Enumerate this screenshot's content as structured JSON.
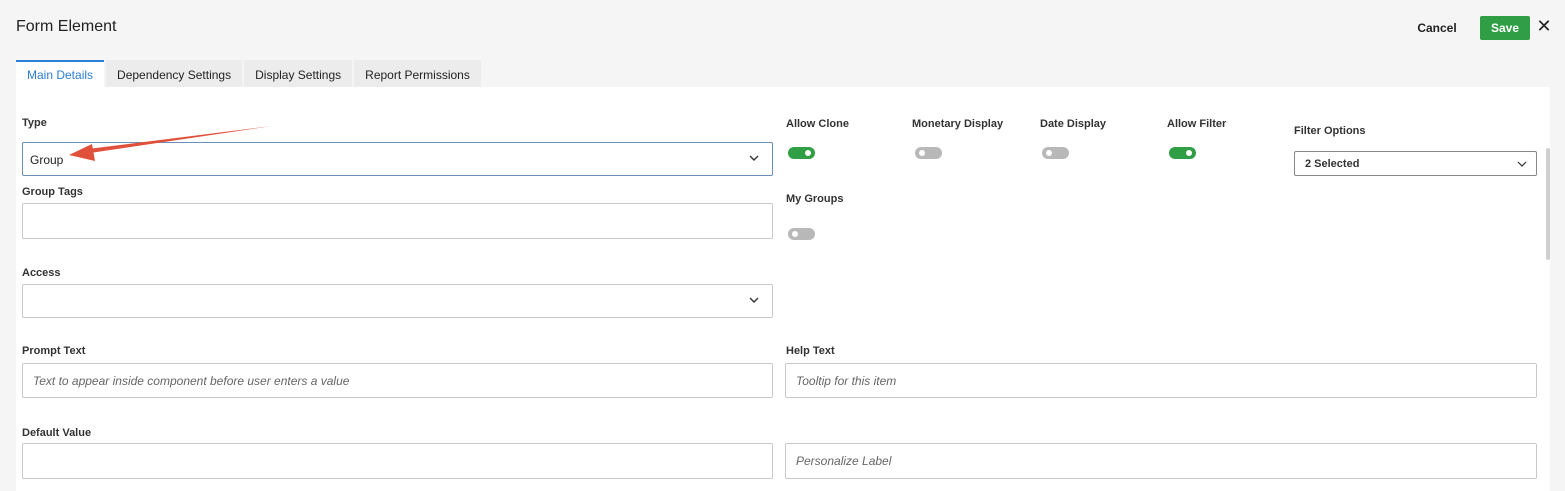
{
  "window": {
    "title": "Form Element"
  },
  "actions": {
    "cancel_label": "Cancel",
    "save_label": "Save",
    "close_glyph": "✕"
  },
  "tabs": [
    {
      "label": "Main Details",
      "active": true
    },
    {
      "label": "Dependency Settings",
      "active": false
    },
    {
      "label": "Display Settings",
      "active": false
    },
    {
      "label": "Report Permissions",
      "active": false
    }
  ],
  "form": {
    "type": {
      "label": "Type",
      "value": "Group"
    },
    "group_tags": {
      "label": "Group Tags",
      "value": ""
    },
    "access": {
      "label": "Access",
      "value": ""
    },
    "prompt_text": {
      "label": "Prompt Text",
      "placeholder": "Text to appear inside component before user enters a value"
    },
    "help_text": {
      "label": "Help Text",
      "placeholder": "Tooltip for this item"
    },
    "default_value": {
      "label": "Default Value",
      "value": ""
    },
    "personalize_label": {
      "placeholder": "Personalize Label"
    }
  },
  "toggles": {
    "allow_clone": {
      "label": "Allow Clone",
      "on": true
    },
    "monetary_display": {
      "label": "Monetary Display",
      "on": false
    },
    "date_display": {
      "label": "Date Display",
      "on": false
    },
    "allow_filter": {
      "label": "Allow Filter",
      "on": true
    },
    "my_groups": {
      "label": "My Groups",
      "on": false
    }
  },
  "filter_options": {
    "label": "Filter Options",
    "value": "2 Selected"
  },
  "colors": {
    "accent": "#2b7fd4",
    "save": "#2f9e44",
    "toggle_on": "#2f9e44",
    "toggle_off": "#b8b8b8",
    "annotation_arrow": "#e0503a"
  },
  "icons": {
    "dropdown": "chevron-down-icon",
    "close": "close-icon",
    "annotation": "red-arrow-annotation"
  }
}
